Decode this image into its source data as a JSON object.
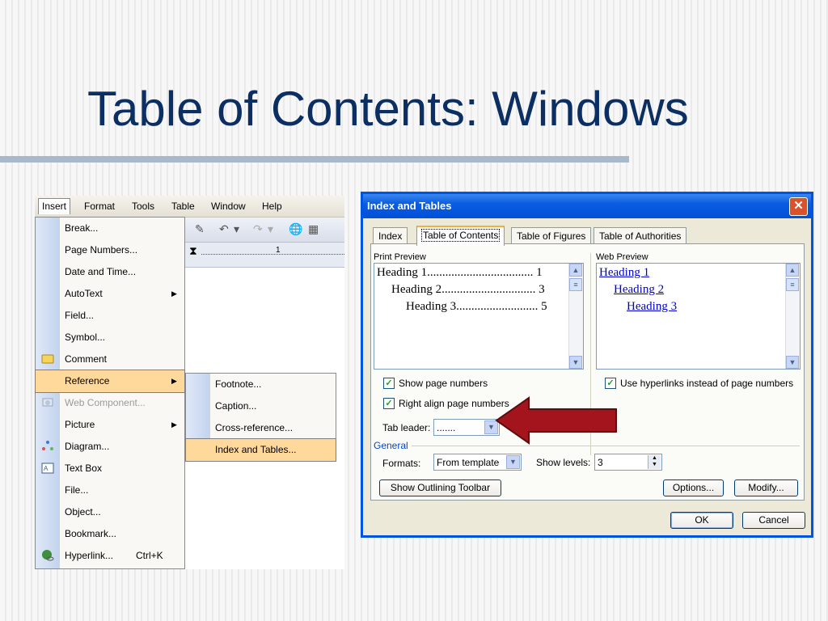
{
  "slide": {
    "title": "Table of Contents: Windows"
  },
  "word": {
    "menubar": [
      "Insert",
      "Format",
      "Tools",
      "Table",
      "Window",
      "Help"
    ],
    "ruler_number": "1",
    "insert_menu": [
      {
        "label": "Break...",
        "icon": ""
      },
      {
        "label": "Page Numbers...",
        "icon": ""
      },
      {
        "label": "Date and Time...",
        "icon": ""
      },
      {
        "label": "AutoText",
        "icon": "",
        "submenu": true
      },
      {
        "label": "Field...",
        "icon": ""
      },
      {
        "label": "Symbol...",
        "icon": ""
      },
      {
        "label": "Comment",
        "icon": "comment-icon"
      },
      {
        "label": "Reference",
        "icon": "",
        "submenu": true,
        "highlighted": true
      },
      {
        "label": "Web Component...",
        "icon": "web-component-icon",
        "disabled": true
      },
      {
        "label": "Picture",
        "icon": "",
        "submenu": true
      },
      {
        "label": "Diagram...",
        "icon": "diagram-icon"
      },
      {
        "label": "Text Box",
        "icon": "text-box-icon"
      },
      {
        "label": "File...",
        "icon": ""
      },
      {
        "label": "Object...",
        "icon": ""
      },
      {
        "label": "Bookmark...",
        "icon": ""
      },
      {
        "label": "Hyperlink...",
        "icon": "hyperlink-icon",
        "shortcut": "Ctrl+K"
      }
    ],
    "reference_submenu": [
      {
        "label": "Footnote..."
      },
      {
        "label": "Caption..."
      },
      {
        "label": "Cross-reference..."
      },
      {
        "label": "Index and Tables...",
        "highlighted": true
      }
    ]
  },
  "dialog": {
    "title": "Index and Tables",
    "close_glyph": "✕",
    "tabs": [
      "Index",
      "Table of Contents",
      "Table of Figures",
      "Table of Authorities"
    ],
    "active_tab": "Table of Contents",
    "print_preview": {
      "label": "Print Preview",
      "lines": [
        {
          "text": "Heading 1",
          "dots": "...................................",
          "page": "1"
        },
        {
          "text": "Heading 2",
          "dots": "...............................",
          "page": "3"
        },
        {
          "text": "Heading 3",
          "dots": "...........................",
          "page": "5"
        }
      ]
    },
    "web_preview": {
      "label": "Web Preview",
      "lines": [
        "Heading 1",
        "Heading 2",
        "Heading 3"
      ]
    },
    "show_page_numbers": {
      "label": "Show page numbers",
      "checked": true
    },
    "right_align": {
      "label": "Right align page numbers",
      "checked": true
    },
    "use_hyperlinks": {
      "label": "Use hyperlinks instead of page numbers",
      "checked": true
    },
    "tab_leader": {
      "label": "Tab leader:",
      "value": "......."
    },
    "general_label": "General",
    "formats": {
      "label": "Formats:",
      "value": "From template"
    },
    "show_levels": {
      "label": "Show levels:",
      "value": "3"
    },
    "buttons": {
      "outlining": "Show Outlining Toolbar",
      "options": "Options...",
      "modify": "Modify...",
      "ok": "OK",
      "cancel": "Cancel"
    }
  },
  "colors": {
    "title": "#0b2e63",
    "menu_highlight": "#ffd89c",
    "dialog_title_bar": "#0a5ce0",
    "arrow": "#a3141c",
    "hyperlink": "#0000cc"
  }
}
